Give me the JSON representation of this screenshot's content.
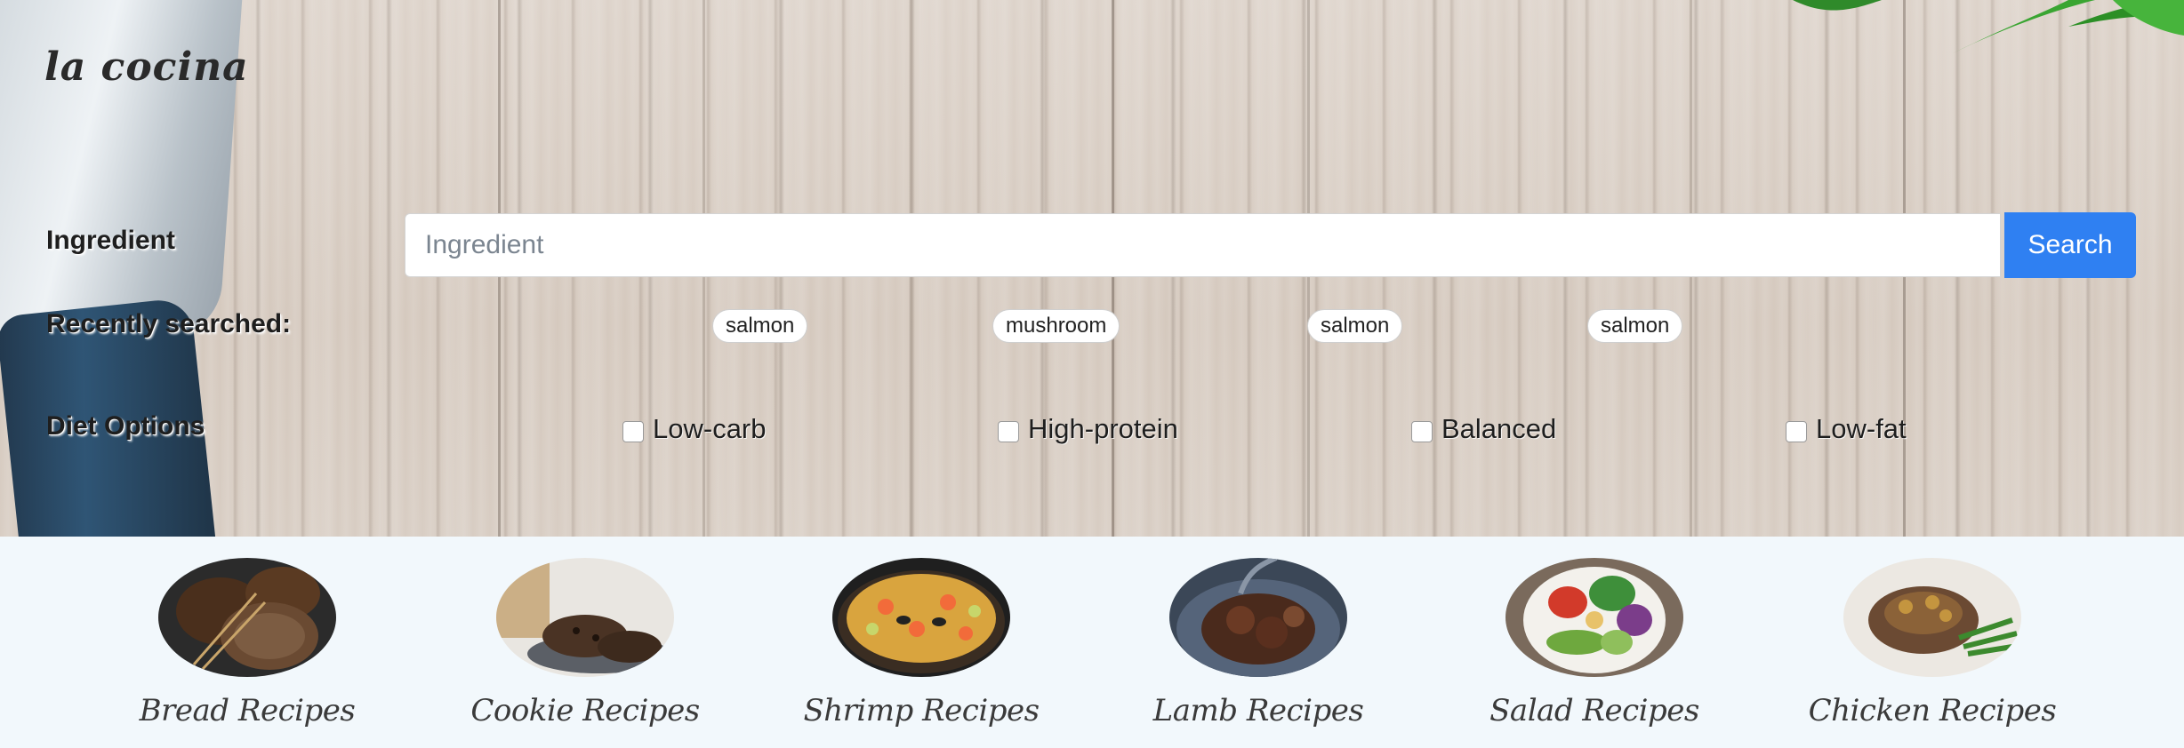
{
  "brand": {
    "title": "la cocina"
  },
  "search": {
    "label": "Ingredient",
    "placeholder": "Ingredient",
    "value": "",
    "button_label": "Search"
  },
  "recent": {
    "label": "Recently searched:",
    "items": [
      "salmon",
      "mushroom",
      "salmon",
      "salmon"
    ]
  },
  "diet": {
    "label": "Diet Options",
    "options": [
      {
        "label": "Low-carb",
        "checked": false
      },
      {
        "label": "High-protein",
        "checked": false
      },
      {
        "label": "Balanced",
        "checked": false
      },
      {
        "label": "Low-fat",
        "checked": false
      }
    ]
  },
  "categories": [
    {
      "label": "Bread Recipes",
      "icon": "bread-image"
    },
    {
      "label": "Cookie Recipes",
      "icon": "cookie-image"
    },
    {
      "label": "Shrimp Recipes",
      "icon": "shrimp-paella-image"
    },
    {
      "label": "Lamb Recipes",
      "icon": "lamb-image"
    },
    {
      "label": "Salad Recipes",
      "icon": "salad-image"
    },
    {
      "label": "Chicken Recipes",
      "icon": "chicken-image"
    }
  ],
  "colors": {
    "accent": "#2f80f2",
    "strip_background": "#f2f8fc",
    "wood": "#d9cec4"
  }
}
